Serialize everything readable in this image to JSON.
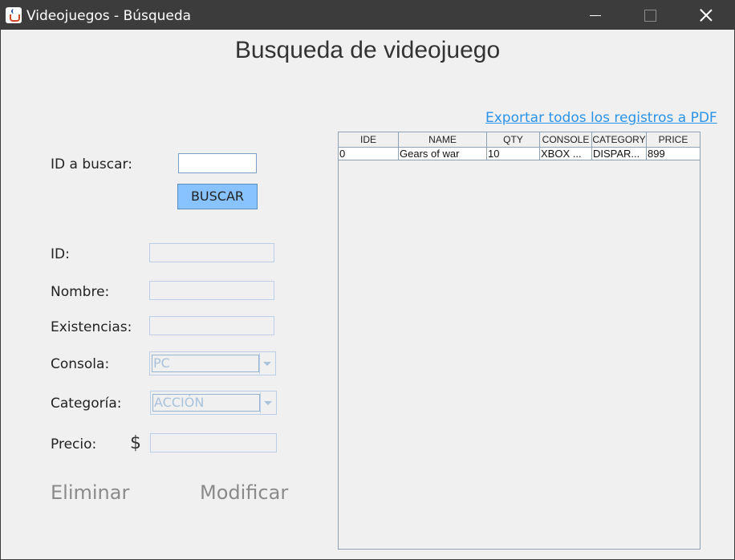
{
  "window": {
    "title": "Videojuegos - Búsqueda",
    "icon": "java-cup-icon"
  },
  "heading": "Busqueda de videojuego",
  "search": {
    "label": "ID a buscar:",
    "value": "",
    "button_label": "BUSCAR",
    "button_color": "#88c3ff"
  },
  "form": {
    "id_label": "ID:",
    "id_value": "",
    "name_label": "Nombre:",
    "name_value": "",
    "stock_label": "Existencias:",
    "stock_value": "",
    "console_label": "Consola:",
    "console_value": "PC",
    "category_label": "Categoría:",
    "category_value": "ACCIÓN",
    "price_label": "Precio:",
    "currency_symbol": "$",
    "price_value": ""
  },
  "actions": {
    "delete_label": "Eliminar",
    "modify_label": "Modificar"
  },
  "export_link": "Exportar todos los registros a PDF",
  "table": {
    "columns": [
      "IDE",
      "NAME",
      "QTY",
      "CONSOLE",
      "CATEGORY",
      "PRICE"
    ],
    "rows": [
      [
        "0",
        "Gears of war",
        "10",
        "XBOX ...",
        "DISPAR...",
        "899"
      ]
    ]
  }
}
